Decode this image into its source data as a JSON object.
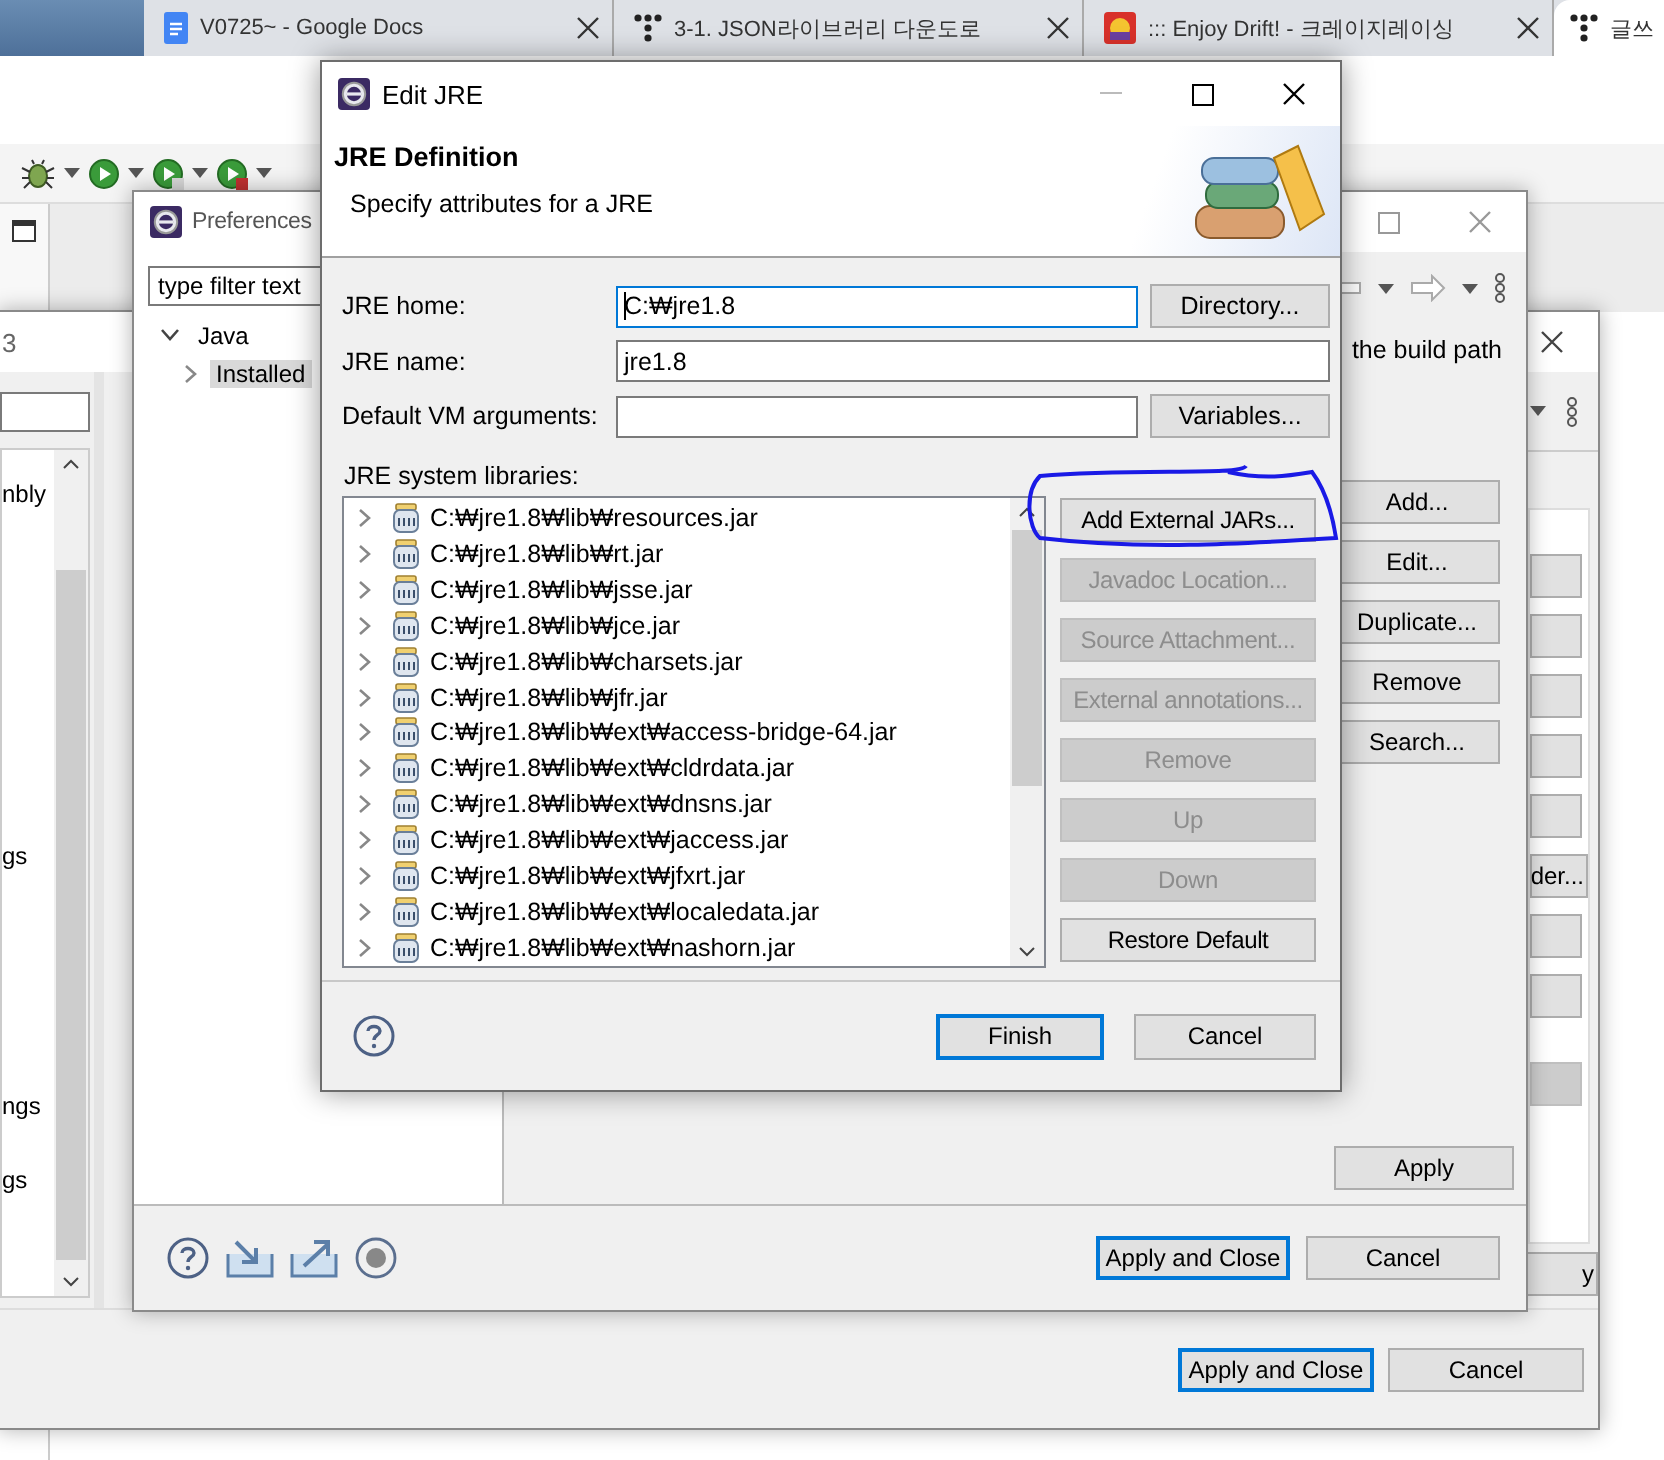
{
  "browser_tabs": [
    {
      "kind": "docs",
      "title": "V0725~ - Google Docs",
      "selected": false
    },
    {
      "kind": "dots",
      "title": "3-1. JSON라이브러리 다운도로",
      "selected": false
    },
    {
      "kind": "game",
      "title": "::: Enjoy Drift! - 크레이지레이싱",
      "selected": false
    },
    {
      "kind": "dots",
      "title": "글쓰",
      "selected": true
    }
  ],
  "back_dialog": {
    "title": "3",
    "list_items": [
      "nbly",
      "gs",
      "ngs",
      "gs"
    ],
    "side_buttons": [
      {
        "kind": "blank"
      },
      {
        "kind": "blank"
      },
      {
        "kind": "blank"
      },
      {
        "kind": "blank"
      },
      {
        "kind": "blank"
      },
      {
        "kind": "text",
        "label": "der..."
      },
      {
        "kind": "blank"
      },
      {
        "kind": "blank"
      },
      {
        "kind": "shaded"
      }
    ],
    "apply_button": "y",
    "buttons": [
      {
        "label": "Apply and Close",
        "default": true
      },
      {
        "label": "Cancel",
        "default": false
      }
    ]
  },
  "preferences": {
    "title": "Preferences",
    "filter": {
      "value": "type filter text"
    },
    "tree": [
      {
        "label": "Java",
        "expanded": true,
        "selected": false,
        "children": [
          {
            "label": "Installed",
            "expanded": false,
            "selected": true
          }
        ]
      }
    ],
    "description": "the build path",
    "side_buttons": [
      "Add...",
      "Edit...",
      "Duplicate...",
      "Remove",
      "Search..."
    ],
    "apply_button": "Apply",
    "buttons": [
      {
        "label": "Apply and Close",
        "default": true
      },
      {
        "label": "Cancel",
        "default": false
      }
    ]
  },
  "edit_jre": {
    "title": "Edit JRE",
    "heading": "JRE Definition",
    "subtitle": "Specify attributes for a JRE",
    "fields": [
      {
        "label": "JRE home:",
        "value": "C:₩jre1.8",
        "focused": true,
        "button": "Directory..."
      },
      {
        "label": "JRE name:",
        "value": "jre1.8",
        "focused": false
      },
      {
        "label": "Default VM arguments:",
        "focused": false,
        "button": "Variables..."
      }
    ],
    "libraries_label": "JRE system libraries:",
    "libraries": [
      "C:₩jre1.8₩lib₩resources.jar",
      "C:₩jre1.8₩lib₩rt.jar",
      "C:₩jre1.8₩lib₩jsse.jar",
      "C:₩jre1.8₩lib₩jce.jar",
      "C:₩jre1.8₩lib₩charsets.jar",
      "C:₩jre1.8₩lib₩jfr.jar",
      "C:₩jre1.8₩lib₩ext₩access-bridge-64.jar",
      "C:₩jre1.8₩lib₩ext₩cldrdata.jar",
      "C:₩jre1.8₩lib₩ext₩dnsns.jar",
      "C:₩jre1.8₩lib₩ext₩jaccess.jar",
      "C:₩jre1.8₩lib₩ext₩jfxrt.jar",
      "C:₩jre1.8₩lib₩ext₩localedata.jar",
      "C:₩jre1.8₩lib₩ext₩nashorn.jar"
    ],
    "side_buttons": [
      {
        "label": "Add External JARs...",
        "disabled": false
      },
      {
        "label": "Javadoc Location...",
        "disabled": true
      },
      {
        "label": "Source Attachment...",
        "disabled": true
      },
      {
        "label": "External annotations...",
        "disabled": true
      },
      {
        "label": "Remove",
        "disabled": true
      },
      {
        "label": "Up",
        "disabled": true
      },
      {
        "label": "Down",
        "disabled": true
      },
      {
        "label": "Restore Default",
        "disabled": false
      }
    ],
    "buttons": [
      {
        "label": "Finish",
        "default": true
      },
      {
        "label": "Cancel",
        "default": false
      }
    ]
  }
}
